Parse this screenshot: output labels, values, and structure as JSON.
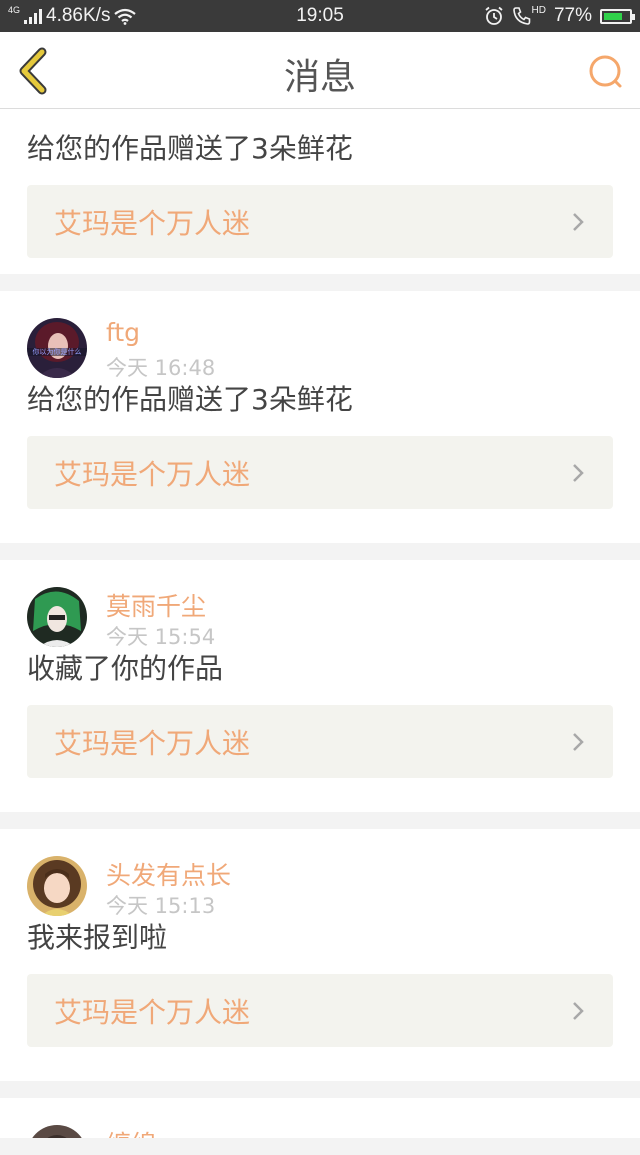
{
  "status_bar": {
    "network_type": "4G",
    "speed": "4.86K/s",
    "time": "19:05",
    "hd": "HD",
    "battery": "77%",
    "battery_level": 0.77,
    "icons": [
      "signal-icon",
      "wifi-icon",
      "alarm-icon",
      "phone-hd-icon",
      "battery-icon"
    ]
  },
  "header": {
    "title": "消息",
    "back_icon": "chevron-left-icon",
    "search_icon": "search-icon",
    "accent_color": "#f5a76b",
    "back_color": "#e5c93c"
  },
  "messages": [
    {
      "text": "给您的作品赠送了3朵鲜花",
      "work": "艾玛是个万人迷"
    },
    {
      "user": "ftg",
      "time": "今天  16:48",
      "avatar_overlay_text": "你以为你是什么",
      "text": "给您的作品赠送了3朵鲜花",
      "work": "艾玛是个万人迷"
    },
    {
      "user": "莫雨千尘",
      "time": "今天  15:54",
      "text": "收藏了你的作品",
      "work": "艾玛是个万人迷"
    },
    {
      "user": "头发有点长",
      "time": "今天  15:13",
      "text": "我来报到啦",
      "work": "艾玛是个万人迷"
    },
    {
      "user": "缠绵"
    }
  ]
}
